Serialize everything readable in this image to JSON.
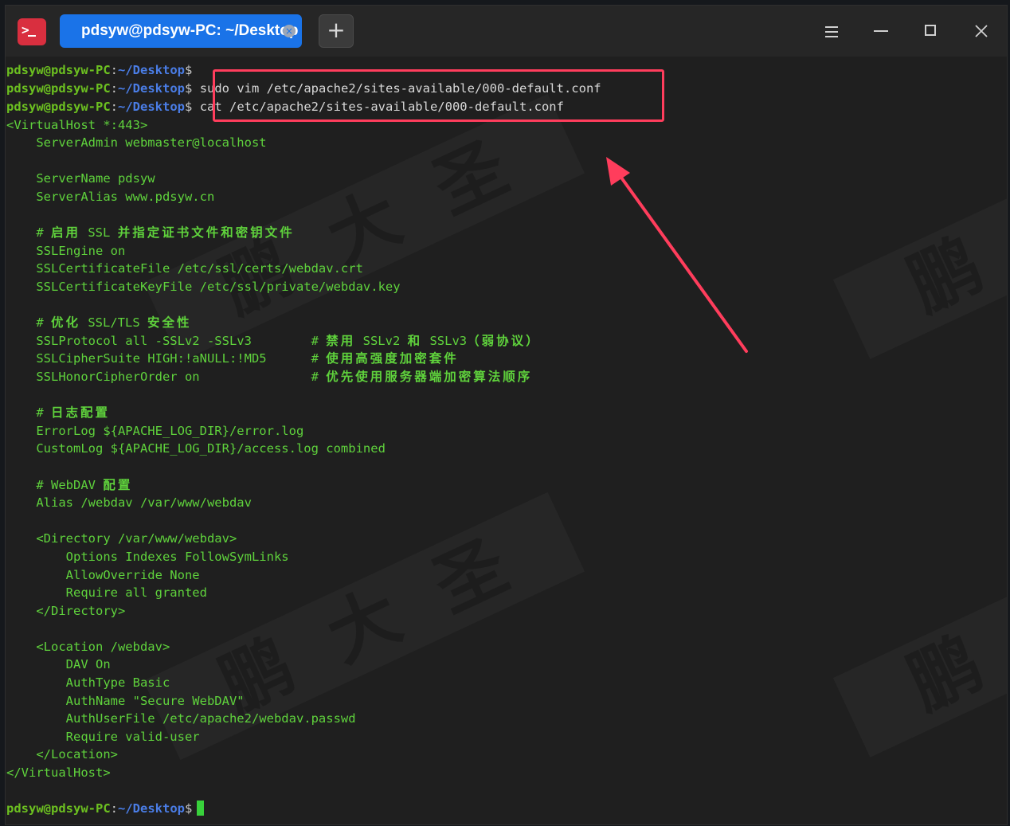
{
  "window": {
    "tab_title": "pdsyw@pdsyw-PC: ~/Desktop",
    "tab_close": "×",
    "new_tab": "+"
  },
  "prompt": {
    "user": "pdsyw@pdsyw-PC",
    "colon": ":",
    "path": "~/Desktop",
    "dollar": "$"
  },
  "commands": {
    "vim": "sudo vim /etc/apache2/sites-available/000-default.conf",
    "cat": "cat /etc/apache2/sites-available/000-default.conf"
  },
  "config": {
    "l01": "<VirtualHost *:443>",
    "l02": "    ServerAdmin webmaster@localhost",
    "l04": "    ServerName pdsyw",
    "l05": "    ServerAlias www.pdsyw.cn",
    "l07_hash": "    # ",
    "l07_a": "启用",
    "l07_b": " SSL ",
    "l07_c": "并指定证书文件和密钥文件",
    "l08": "    SSLEngine on",
    "l09": "    SSLCertificateFile /etc/ssl/certs/webdav.crt",
    "l10": "    SSLCertificateKeyFile /etc/ssl/private/webdav.key",
    "l12_hash": "    # ",
    "l12_a": "优化",
    "l12_b": " SSL/TLS ",
    "l12_c": "安全性",
    "l13": "    SSLProtocol all -SSLv2 -SSLv3        # ",
    "l13_a": "禁用",
    "l13_b": " SSLv2 ",
    "l13_c": "和",
    "l13_d": " SSLv3",
    "l13_e": "（弱协议）",
    "l14": "    SSLCipherSuite HIGH:!aNULL:!MD5      # ",
    "l14_a": "使用高强度加密套件",
    "l15": "    SSLHonorCipherOrder on               # ",
    "l15_a": "优先使用服务器端加密算法顺序",
    "l17_hash": "    # ",
    "l17_a": "日志配置",
    "l18": "    ErrorLog ${APACHE_LOG_DIR}/error.log",
    "l19": "    CustomLog ${APACHE_LOG_DIR}/access.log combined",
    "l21_hash": "    # WebDAV ",
    "l21_a": "配置",
    "l22": "    Alias /webdav /var/www/webdav",
    "l24": "    <Directory /var/www/webdav>",
    "l25": "        Options Indexes FollowSymLinks",
    "l26": "        AllowOverride None",
    "l27": "        Require all granted",
    "l28": "    </Directory>",
    "l30": "    <Location /webdav>",
    "l31": "        DAV On",
    "l32": "        AuthType Basic",
    "l33": "        AuthName \"Secure WebDAV\"",
    "l34": "        AuthUserFile /etc/apache2/webdav.passwd",
    "l35": "        Require valid-user",
    "l36": "    </Location>",
    "l37": "</VirtualHost>"
  },
  "watermark": {
    "c1": "鹏",
    "c2": "大",
    "c3": "圣"
  },
  "colors": {
    "highlight": "#ff3d5c",
    "prompt_user": "#6cc020",
    "prompt_path": "#4a7de6",
    "text": "#5fd23c",
    "tab_active": "#1a73e8"
  }
}
